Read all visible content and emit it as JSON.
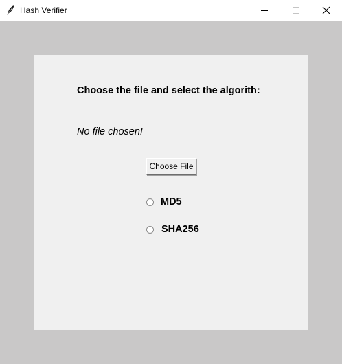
{
  "window": {
    "title": "Hash Verifier",
    "controls": [
      "minimize",
      "maximize",
      "close"
    ]
  },
  "panel": {
    "instruction": "Choose the file and select the algorith:",
    "file_status": "No file chosen!",
    "choose_button_label": "Choose File",
    "algorithms": [
      {
        "label": "MD5",
        "selected": false
      },
      {
        "label": "SHA256",
        "selected": false
      }
    ]
  },
  "colors": {
    "background": "#c9c8c8",
    "panel": "#f0f0f0",
    "titlebar": "#ffffff",
    "text": "#000000"
  },
  "icons": {
    "app": "feather-icon",
    "minimize": "minimize-icon",
    "maximize": "maximize-icon",
    "close": "close-icon"
  }
}
